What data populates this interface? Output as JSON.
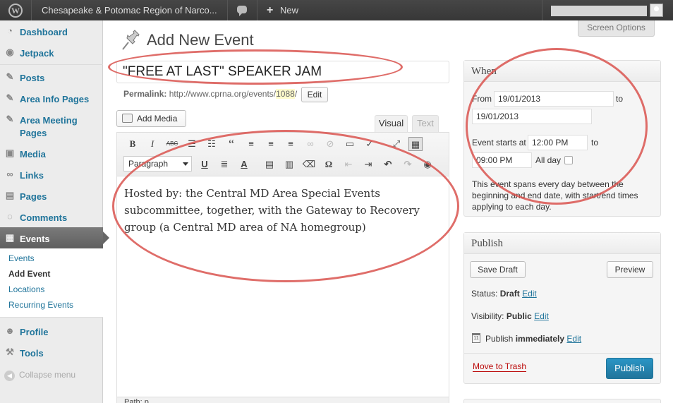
{
  "admin_bar": {
    "site_name": "Chesapeake & Potomac Region of Narco...",
    "new_label": "New",
    "new_icon": "plus-icon",
    "comment_icon": "comment-bubble-icon",
    "logo_icon": "wordpress-logo-icon"
  },
  "sidebar": {
    "items": [
      {
        "label": "Dashboard",
        "icon": "dashboard-icon"
      },
      {
        "label": "Jetpack",
        "icon": "jetpack-icon"
      },
      {
        "label": "Posts",
        "icon": "pushpin-icon"
      },
      {
        "label": "Area Info Pages",
        "icon": "pushpin-icon"
      },
      {
        "label": "Area Meeting Pages",
        "icon": "pushpin-icon"
      },
      {
        "label": "Media",
        "icon": "media-icon"
      },
      {
        "label": "Links",
        "icon": "links-icon"
      },
      {
        "label": "Pages",
        "icon": "pages-icon"
      },
      {
        "label": "Comments",
        "icon": "comments-icon"
      },
      {
        "label": "Events",
        "icon": "events-icon"
      },
      {
        "label": "Profile",
        "icon": "profile-icon"
      },
      {
        "label": "Tools",
        "icon": "tools-icon"
      }
    ],
    "events_submenu": [
      "Events",
      "Add Event",
      "Locations",
      "Recurring Events"
    ],
    "collapse_label": "Collapse menu"
  },
  "header": {
    "screen_options": "Screen Options",
    "page_title": "Add New Event"
  },
  "editor": {
    "title_value": "\"FREE AT LAST\" SPEAKER JAM",
    "permalink_label": "Permalink:",
    "permalink_base": "http://www.cprna.org/events/",
    "permalink_slug": "1088",
    "permalink_tail": "/",
    "edit_label": "Edit",
    "add_media_label": "Add Media",
    "tab_visual": "Visual",
    "tab_text": "Text",
    "format_select": "Paragraph",
    "content": "Hosted by: the Central MD Area Special Events subcommittee, together, with the Gateway to Recovery group (a Central MD area of NA homegroup)",
    "path_label": "Path: p"
  },
  "when_box": {
    "title": "When",
    "from_label": "From",
    "from_date": "19/01/2013",
    "to_label": "to",
    "to_date": "19/01/2013",
    "starts_label": "Event starts at",
    "start_time": "12:00 PM",
    "to_label2": "to",
    "end_time": "09:00 PM",
    "all_day_label": "All day",
    "all_day_checked": false,
    "note": "This event spans every day between the beginning and end date, with start/end times applying to each day."
  },
  "publish_box": {
    "title": "Publish",
    "save_draft": "Save Draft",
    "preview": "Preview",
    "status_label": "Status:",
    "status_value": "Draft",
    "visibility_label": "Visibility:",
    "visibility_value": "Public",
    "publish_label": "Publish",
    "publish_value": "immediately",
    "edit_label": "Edit",
    "trash_label": "Move to Trash",
    "publish_button": "Publish"
  },
  "colors": {
    "link": "#21759b",
    "admin_bar": "#464646",
    "annotation_red": "#d9534f",
    "publish_button": "#21759b",
    "trash": "#bc0b0b"
  }
}
